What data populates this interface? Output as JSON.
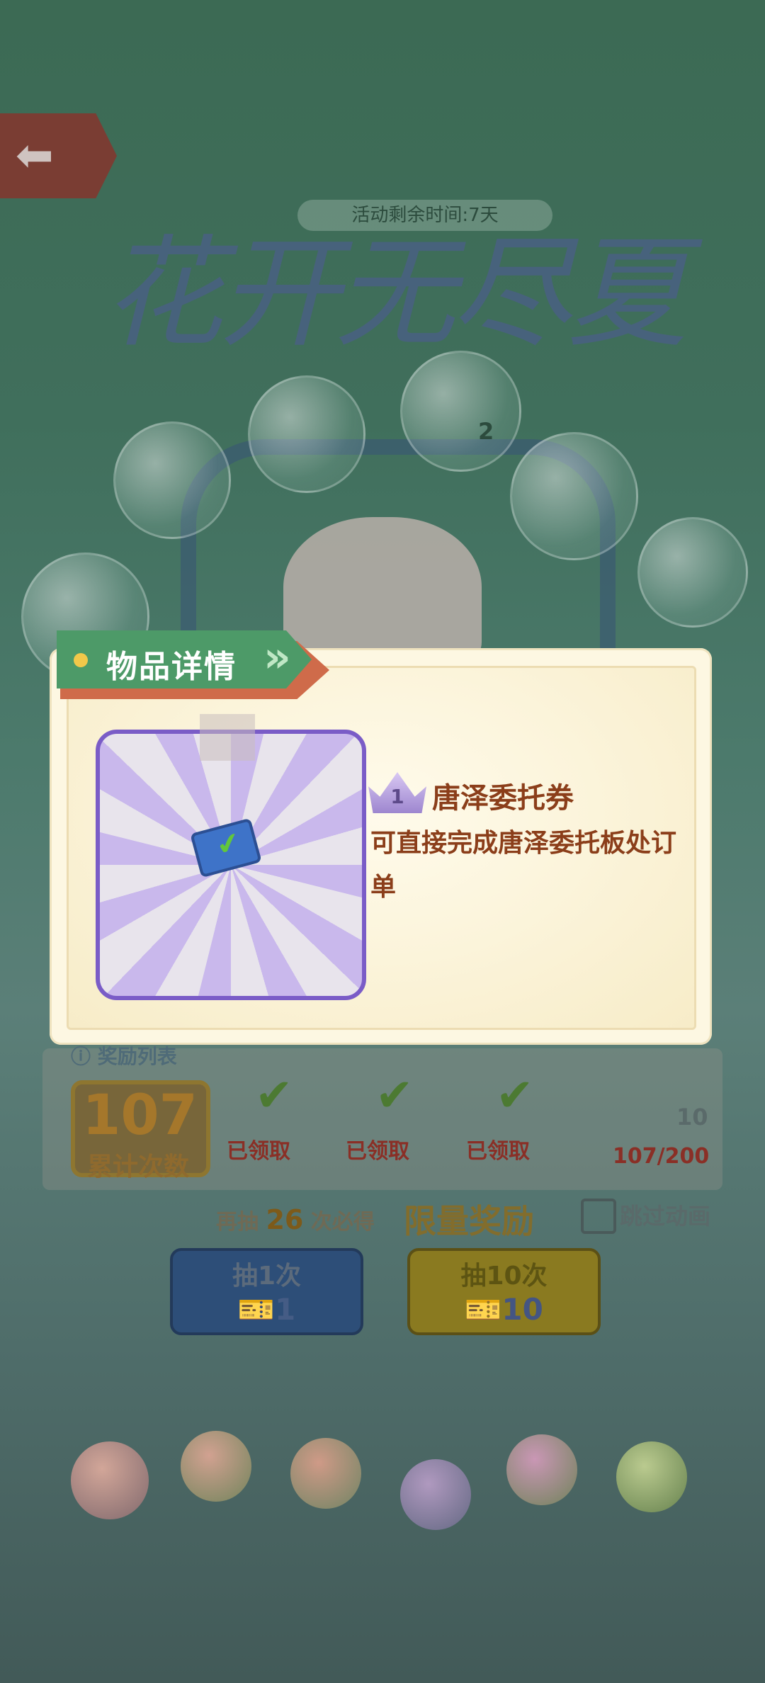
{
  "header": {
    "back_icon": "arrow-left-icon",
    "event_timer": "活动剩余时间:7天",
    "event_title": "花开无尽夏"
  },
  "background": {
    "prize_bubble_count": "2"
  },
  "reward_panel": {
    "header": "奖励列表",
    "counter_value": "107",
    "counter_label": "累计次数",
    "claimed_label": "已领取",
    "progress": "107/200",
    "final_reward_count": "10"
  },
  "draw_area": {
    "again_prefix": "再抽",
    "again_count": "26",
    "again_suffix": "次必得",
    "limited_label": "限量奖励",
    "skip_label": "跳过动画",
    "draw_once_label": "抽1次",
    "draw_once_cost": "1",
    "draw_ten_label": "抽10次",
    "draw_ten_cost": "10"
  },
  "modal": {
    "tab_title": "物品详情",
    "item_level": "1",
    "item_name": "唐泽委托券",
    "item_description": "可直接完成唐泽委托板处订单",
    "item_icon": "ticket-icon"
  },
  "colors": {
    "tab_green": "#4d9a68",
    "tab_red": "#cf6b4a",
    "frame_purple": "#7a5cc7",
    "text_brown": "#8b3e1a"
  }
}
